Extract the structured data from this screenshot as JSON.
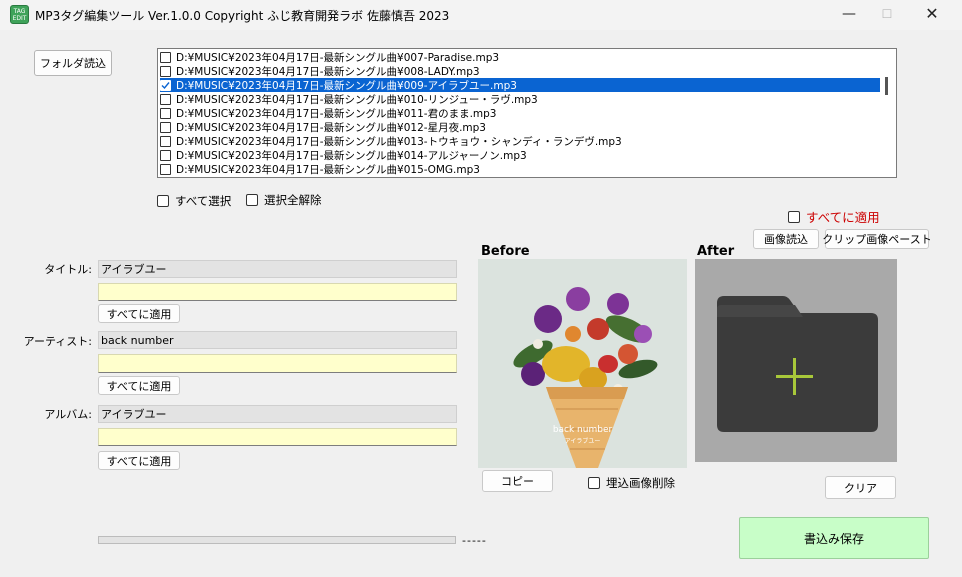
{
  "window": {
    "icon_text_top": "TAG",
    "icon_text_bottom": "EDIT",
    "title": "MP3タグ編集ツール Ver.1.0.0  Copyright ふじ教育開発ラボ 佐藤慎吾  2023",
    "minimize": "—",
    "maximize": "☐",
    "close": "✕"
  },
  "toolbar": {
    "load_folder": "フォルダ読込"
  },
  "file_list": {
    "items": [
      {
        "text": "D:¥MUSIC¥2023年04月17日-最新シングル曲¥007-Paradise.mp3",
        "checked": false,
        "selected": false
      },
      {
        "text": "D:¥MUSIC¥2023年04月17日-最新シングル曲¥008-LADY.mp3",
        "checked": false,
        "selected": false
      },
      {
        "text": "D:¥MUSIC¥2023年04月17日-最新シングル曲¥009-アイラブユー.mp3",
        "checked": true,
        "selected": true
      },
      {
        "text": "D:¥MUSIC¥2023年04月17日-最新シングル曲¥010-リンジュー・ラヴ.mp3",
        "checked": false,
        "selected": false
      },
      {
        "text": "D:¥MUSIC¥2023年04月17日-最新シングル曲¥011-君のまま.mp3",
        "checked": false,
        "selected": false
      },
      {
        "text": "D:¥MUSIC¥2023年04月17日-最新シングル曲¥012-星月夜.mp3",
        "checked": false,
        "selected": false
      },
      {
        "text": "D:¥MUSIC¥2023年04月17日-最新シングル曲¥013-トウキョウ・シャンディ・ランデヴ.mp3",
        "checked": false,
        "selected": false
      },
      {
        "text": "D:¥MUSIC¥2023年04月17日-最新シングル曲¥014-アルジャーノン.mp3",
        "checked": false,
        "selected": false
      },
      {
        "text": "D:¥MUSIC¥2023年04月17日-最新シングル曲¥015-OMG.mp3",
        "checked": false,
        "selected": false
      }
    ]
  },
  "selection": {
    "select_all": "すべて選択",
    "deselect_all": "選択全解除"
  },
  "apply_all_top": "すべてに適用",
  "apply_all_color": "#cc0000",
  "fields": {
    "title": {
      "label": "タイトル:",
      "current": "アイラブユー",
      "new_value": "",
      "apply": "すべてに適用"
    },
    "artist": {
      "label": "アーティスト:",
      "current": "back number",
      "new_value": "",
      "apply": "すべてに適用"
    },
    "album": {
      "label": "アルバム:",
      "current": "アイラブユー",
      "new_value": "",
      "apply": "すべてに適用"
    }
  },
  "before": {
    "title": "Before",
    "cover_text": "back number",
    "cover_subtext": "アイラブユー",
    "copy": "コピー",
    "delete_embedded": "埋込画像削除"
  },
  "after": {
    "title": "After",
    "load_image": "画像読込",
    "paste_clip": "クリップ画像ペースト",
    "clear": "クリア"
  },
  "status": {
    "progress": 0,
    "text": "-----"
  },
  "save_button": "書込み保存",
  "colors": {
    "selection": "#0a64d2",
    "input_bg": "#ffffcc",
    "save_bg": "#c8fec8",
    "plus": "#a8c83a"
  }
}
